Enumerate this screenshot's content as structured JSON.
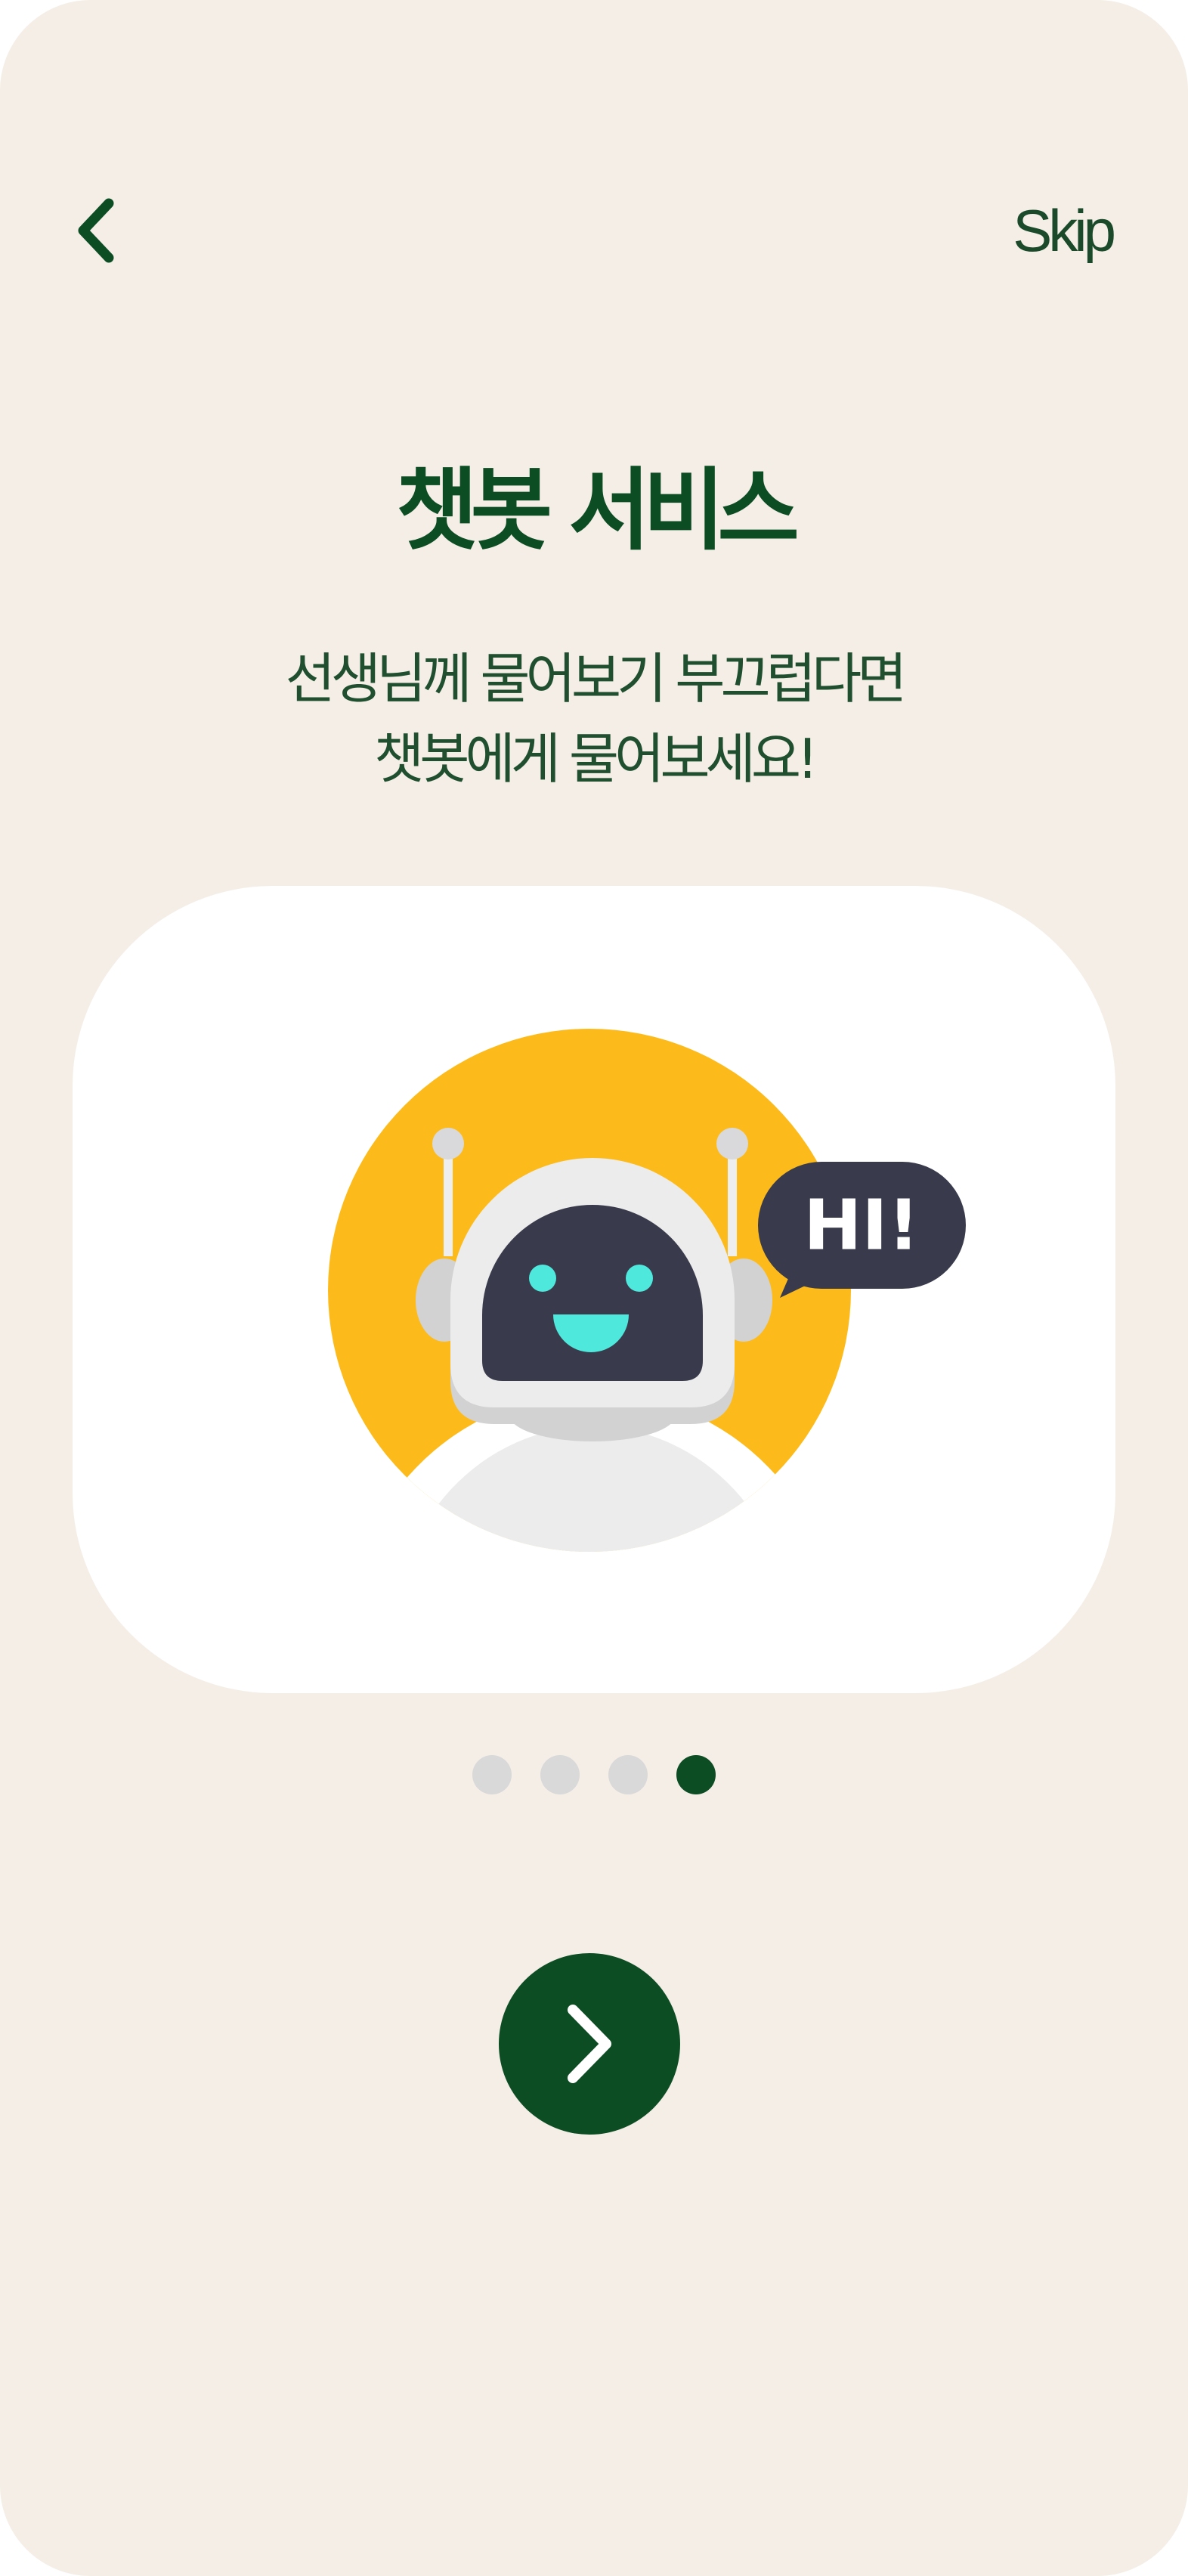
{
  "header": {
    "back_icon": "chevron-left-icon",
    "skip_label": "Skip"
  },
  "main": {
    "title": "챗봇 서비스",
    "description_line1": "선생님께 물어보기 부끄럽다면",
    "description_line2": "챗봇에게 물어보세요!"
  },
  "illustration": {
    "icon": "robot-chatbot-illustration",
    "speech_bubble_text": "HI!"
  },
  "pagination": {
    "total": 4,
    "current": 4
  },
  "footer": {
    "next_icon": "chevron-right-icon"
  },
  "colors": {
    "background": "#f4eee6",
    "primary": "#0d4d24",
    "accent_yellow": "#fdbb1b",
    "inactive_dot": "#d9d9d9"
  }
}
